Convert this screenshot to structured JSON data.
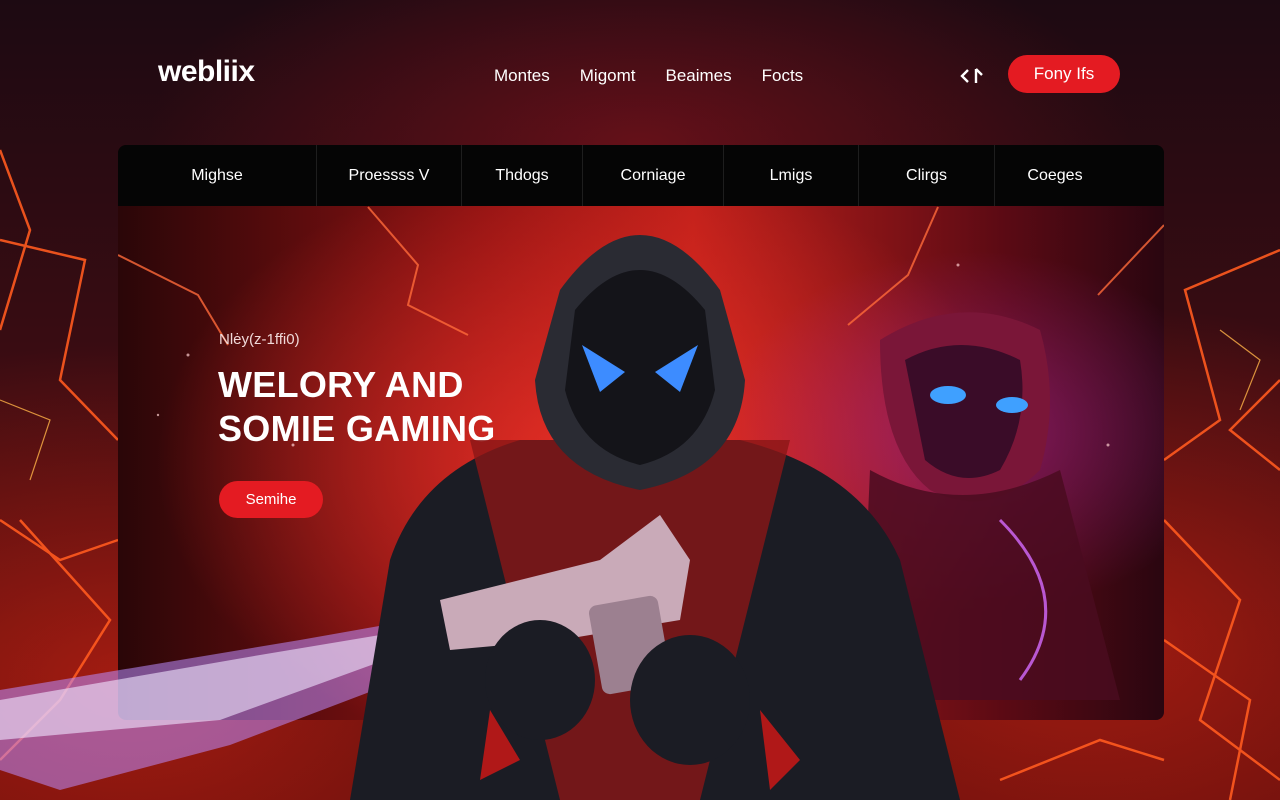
{
  "brand": {
    "logo": "webliix",
    "accent": "#e41b22"
  },
  "topnav": {
    "items": [
      "Montes",
      "Migomt",
      "Beaimes",
      "Focts"
    ]
  },
  "header": {
    "share_icon": "share-icon",
    "cta_label": "Fony Ifs"
  },
  "categories": [
    "Mighse",
    "Proessss V",
    "Thdogs",
    "Corniage",
    "Lmigs",
    "Clirgs",
    "Coeges"
  ],
  "hero": {
    "kicker": "Nlėy(z-1ffi0)",
    "headline_line1": "WELORY AND",
    "headline_line2": "SOMIE GAMING",
    "button_label": "Semihe"
  }
}
